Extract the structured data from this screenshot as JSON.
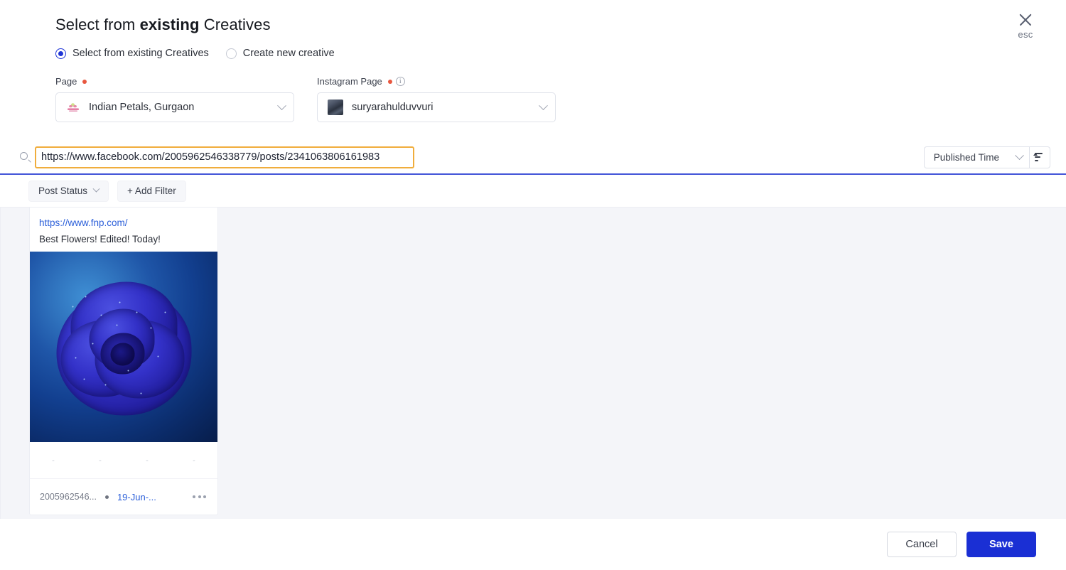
{
  "header": {
    "title_prefix": "Select from ",
    "title_bold": "existing",
    "title_suffix": " Creatives",
    "close_icon": "close-icon",
    "close_label": "esc"
  },
  "mode_options": [
    {
      "label": "Select from existing Creatives",
      "selected": true
    },
    {
      "label": "Create new creative",
      "selected": false
    }
  ],
  "fields": {
    "page": {
      "label": "Page",
      "required": true,
      "value": "Indian Petals, Gurgaon",
      "icon": "page-logo-icon"
    },
    "instagram": {
      "label": "Instagram Page",
      "required": true,
      "info_icon": "info-icon",
      "value": "suryarahulduvvuri",
      "icon": "avatar"
    }
  },
  "search": {
    "icon": "search-icon",
    "value": "https://www.facebook.com/2005962546338779/posts/2341063806161983",
    "placeholder": "Search",
    "sort_by": "Published Time",
    "sort_direction_icon": "sort-ascending-icon"
  },
  "filters": {
    "post_status_label": "Post Status",
    "add_filter_label": "+ Add Filter"
  },
  "results": {
    "cards": [
      {
        "link": "https://www.fnp.com/",
        "description": "Best Flowers! Edited! Today!",
        "image_alt": "blue-rose-photo",
        "stats": [
          "-",
          "-",
          "-",
          "-"
        ],
        "post_id": "2005962546...",
        "date": "19-Jun-...",
        "menu_icon": "more-options-icon"
      }
    ]
  },
  "footer": {
    "cancel_label": "Cancel",
    "save_label": "Save"
  },
  "colors": {
    "accent_blue": "#1a2fd4",
    "link_blue": "#2b5fd9",
    "focus_orange": "#f0ad3c",
    "required_red": "#e8573f",
    "results_bg": "#f4f5f9"
  }
}
